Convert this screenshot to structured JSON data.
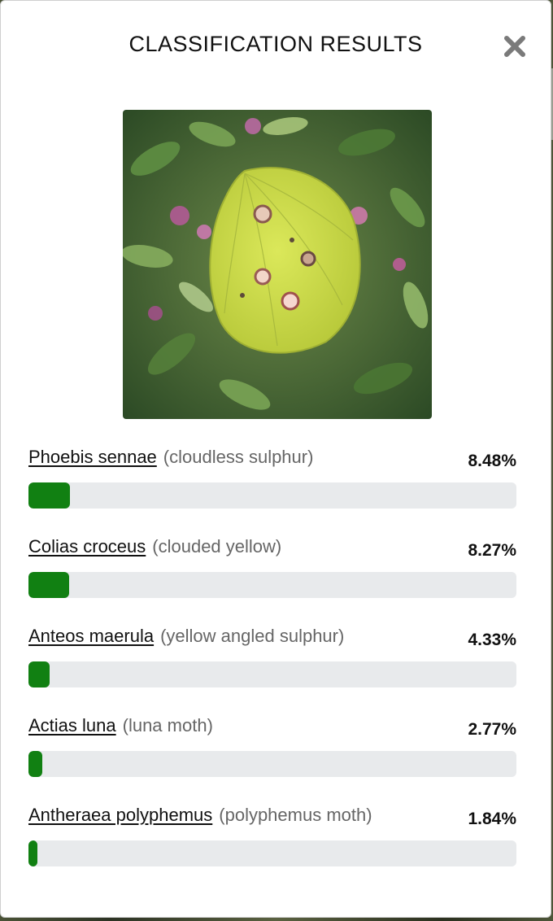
{
  "modal": {
    "title": "CLASSIFICATION RESULTS",
    "close_icon": "close-x-icon"
  },
  "image": {
    "subject": "yellow butterfly on green leaves"
  },
  "results": [
    {
      "scientific_name": "Phoebis sennae",
      "common_name": "(cloudless sulphur)",
      "percent_label": "8.48%",
      "fraction": 0.0848
    },
    {
      "scientific_name": "Colias croceus",
      "common_name": "(clouded yellow)",
      "percent_label": "8.27%",
      "fraction": 0.0827
    },
    {
      "scientific_name": "Anteos maerula",
      "common_name": "(yellow angled sulphur)",
      "percent_label": "4.33%",
      "fraction": 0.0433
    },
    {
      "scientific_name": "Actias luna",
      "common_name": "(luna moth)",
      "percent_label": "2.77%",
      "fraction": 0.0277
    },
    {
      "scientific_name": "Antheraea polyphemus",
      "common_name": "(polyphemus moth)",
      "percent_label": "1.84%",
      "fraction": 0.0184
    }
  ],
  "colors": {
    "bar_fill": "#118012",
    "bar_track": "#e8eaec",
    "close_icon": "#7a7a7a"
  }
}
